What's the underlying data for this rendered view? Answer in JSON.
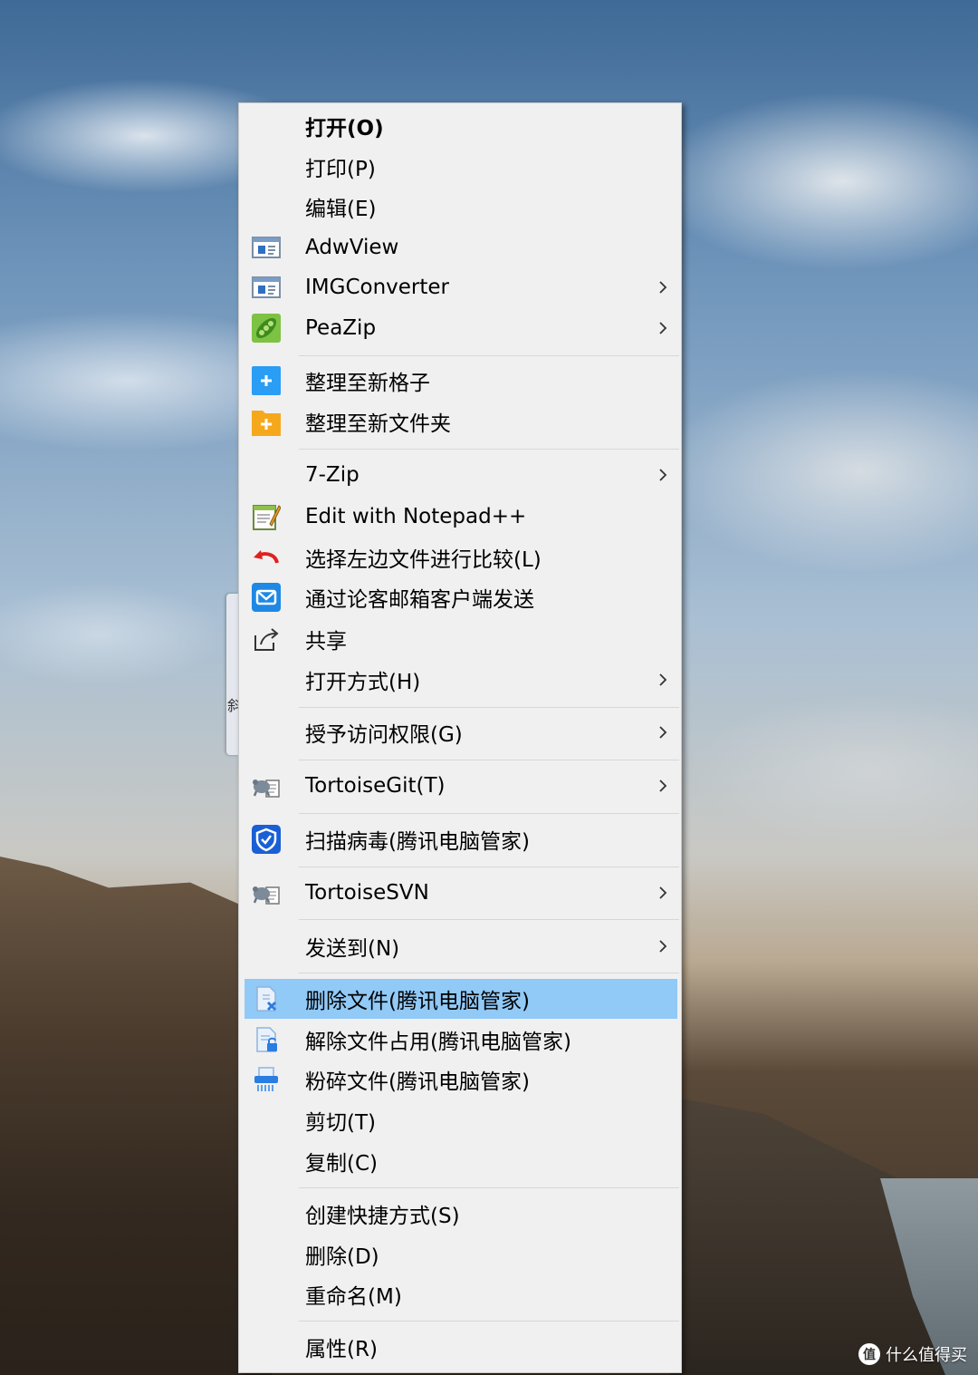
{
  "side_tab": {
    "text": "斜"
  },
  "menu": {
    "items": [
      {
        "label": "打开(O)",
        "icon": "none",
        "bold": true,
        "submenu": false
      },
      {
        "label": "打印(P)",
        "icon": "none",
        "submenu": false
      },
      {
        "label": "编辑(E)",
        "icon": "none",
        "submenu": false
      },
      {
        "label": "AdwView",
        "icon": "app-window-icon",
        "submenu": false
      },
      {
        "label": "IMGConverter",
        "icon": "app-window-icon",
        "submenu": true
      },
      {
        "label": "PeaZip",
        "icon": "peazip-icon",
        "submenu": true
      },
      {
        "label": "整理至新格子",
        "icon": "new-grid-icon",
        "submenu": false
      },
      {
        "label": "整理至新文件夹",
        "icon": "new-folder-icon",
        "submenu": false
      },
      {
        "label": "7-Zip",
        "icon": "none",
        "submenu": true
      },
      {
        "label": "Edit with Notepad++",
        "icon": "notepad-icon",
        "submenu": false
      },
      {
        "label": "选择左边文件进行比较(L)",
        "icon": "compare-icon",
        "submenu": false
      },
      {
        "label": "通过论客邮箱客户端发送",
        "icon": "mail-icon",
        "submenu": false
      },
      {
        "label": "共享",
        "icon": "share-icon",
        "submenu": false
      },
      {
        "label": "打开方式(H)",
        "icon": "none",
        "submenu": true
      },
      {
        "label": "授予访问权限(G)",
        "icon": "none",
        "submenu": true
      },
      {
        "label": "TortoiseGit(T)",
        "icon": "tortoise-icon",
        "submenu": true
      },
      {
        "label": "扫描病毒(腾讯电脑管家)",
        "icon": "shield-icon",
        "submenu": false
      },
      {
        "label": "TortoiseSVN",
        "icon": "tortoise-icon",
        "submenu": true
      },
      {
        "label": "发送到(N)",
        "icon": "none",
        "submenu": true
      },
      {
        "label": "删除文件(腾讯电脑管家)",
        "icon": "delete-file-icon",
        "submenu": false,
        "highlighted": true
      },
      {
        "label": "解除文件占用(腾讯电脑管家)",
        "icon": "unlock-file-icon",
        "submenu": false
      },
      {
        "label": "粉碎文件(腾讯电脑管家)",
        "icon": "shredder-icon",
        "submenu": false
      },
      {
        "label": "剪切(T)",
        "icon": "none",
        "submenu": false
      },
      {
        "label": "复制(C)",
        "icon": "none",
        "submenu": false
      },
      {
        "label": "创建快捷方式(S)",
        "icon": "none",
        "submenu": false
      },
      {
        "label": "删除(D)",
        "icon": "none",
        "submenu": false
      },
      {
        "label": "重命名(M)",
        "icon": "none",
        "submenu": false
      },
      {
        "label": "属性(R)",
        "icon": "none",
        "submenu": false
      }
    ]
  },
  "watermark": {
    "text": "什么值得买",
    "logo_text": "值"
  },
  "colors": {
    "highlight": "#91c9f7",
    "menu_bg": "#f0f0f0",
    "separator": "#d7d7d7"
  }
}
